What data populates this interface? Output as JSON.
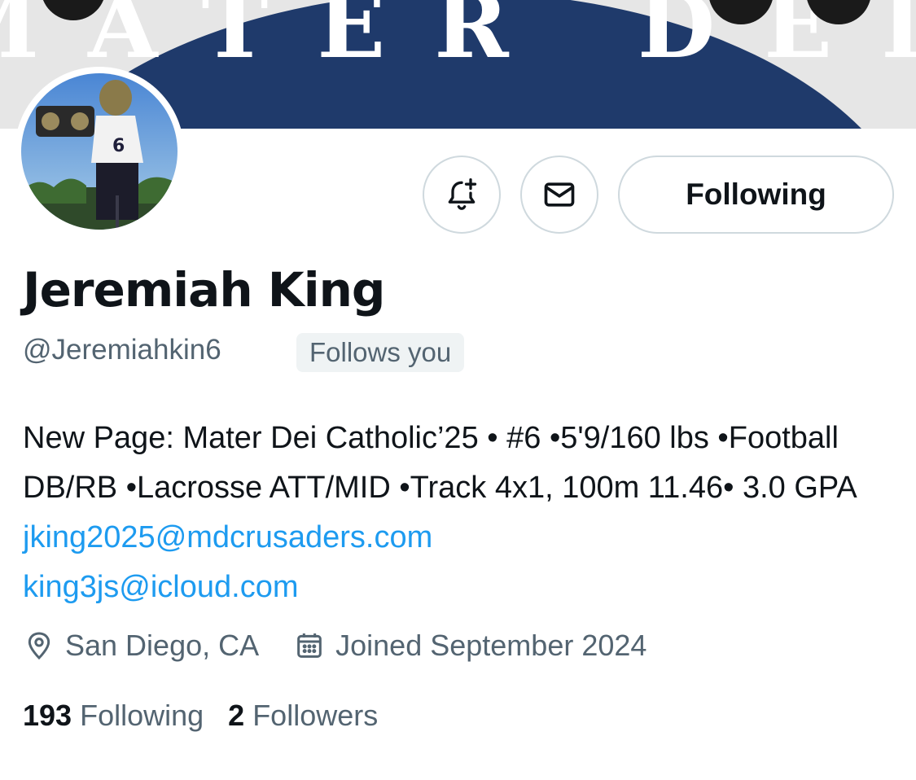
{
  "banner": {
    "text": "MATER DEI",
    "color": "#1f3a6b"
  },
  "profile": {
    "name": "Jeremiah King",
    "handle": "@Jeremiahkin6",
    "follows_you": "Follows you"
  },
  "actions": {
    "notify_icon": "bell-plus-icon",
    "message_icon": "mail-icon",
    "follow_label": "Following"
  },
  "bio": {
    "text": "New Page: Mater Dei Catholic’25 • #6 •5'9/160 lbs •Football DB/RB •Lacrosse ATT/MID •Track 4x1, 100m 11.46• 3.0 GPA ",
    "link1": "jking2025@mdcrusaders.com",
    "link2": "king3js@icloud.com"
  },
  "meta": {
    "location": "San Diego, CA",
    "joined": "Joined September 2024"
  },
  "stats": {
    "following_count": "193",
    "following_label": "Following",
    "followers_count": "2",
    "followers_label": "Followers"
  },
  "colors": {
    "link": "#1d9bf0",
    "secondary": "#536471",
    "border": "#cfd9de"
  }
}
